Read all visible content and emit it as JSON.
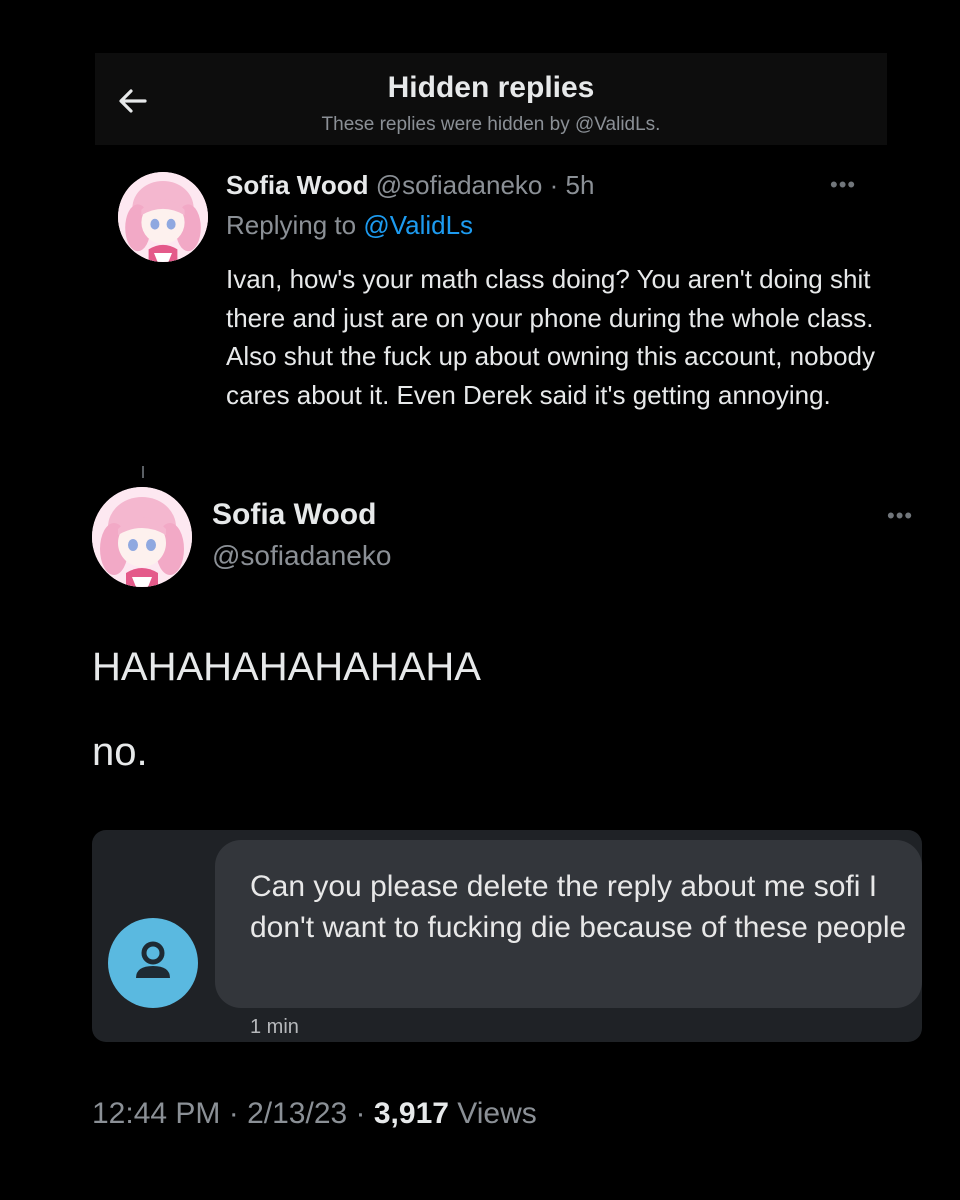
{
  "header": {
    "title": "Hidden replies",
    "subtitle": "These replies were hidden by @ValidLs.",
    "back_icon": "arrow-left-icon"
  },
  "hidden_reply": {
    "name": "Sofia Wood",
    "handle": "@sofiadaneko",
    "separator": " · ",
    "time": "5h",
    "more_icon": "more-dots-icon",
    "replying_prefix": "Replying to ",
    "replying_to": "@ValidLs",
    "text": "Ivan, how's your math class doing? You aren't doing shit there and just are on your phone during the whole class. Also shut the fuck up about owning this account, nobody cares about it. Even Derek said it's getting annoying."
  },
  "tweet": {
    "name": "Sofia Wood",
    "handle": "@sofiadaneko",
    "more_icon": "more-dots-icon",
    "line1": "HAHAHAHAHAHAHA",
    "line2": "no.",
    "message": {
      "avatar_icon": "person-icon",
      "text": "Can you please delete the reply about me sofi I don't want to fucking die because of these people",
      "time": "1 min"
    },
    "meta": {
      "time": "12:44 PM",
      "sep1": " · ",
      "date": "2/13/23",
      "sep2": " · ",
      "views_count": "3,917",
      "views_label": " Views"
    }
  },
  "colors": {
    "background": "#000000",
    "text_primary": "#e7e9ea",
    "text_secondary": "#8b9096",
    "link": "#1d9bf0",
    "message_card": "#1f2226",
    "message_bubble": "#33363b",
    "message_avatar": "#5ab9e0"
  }
}
